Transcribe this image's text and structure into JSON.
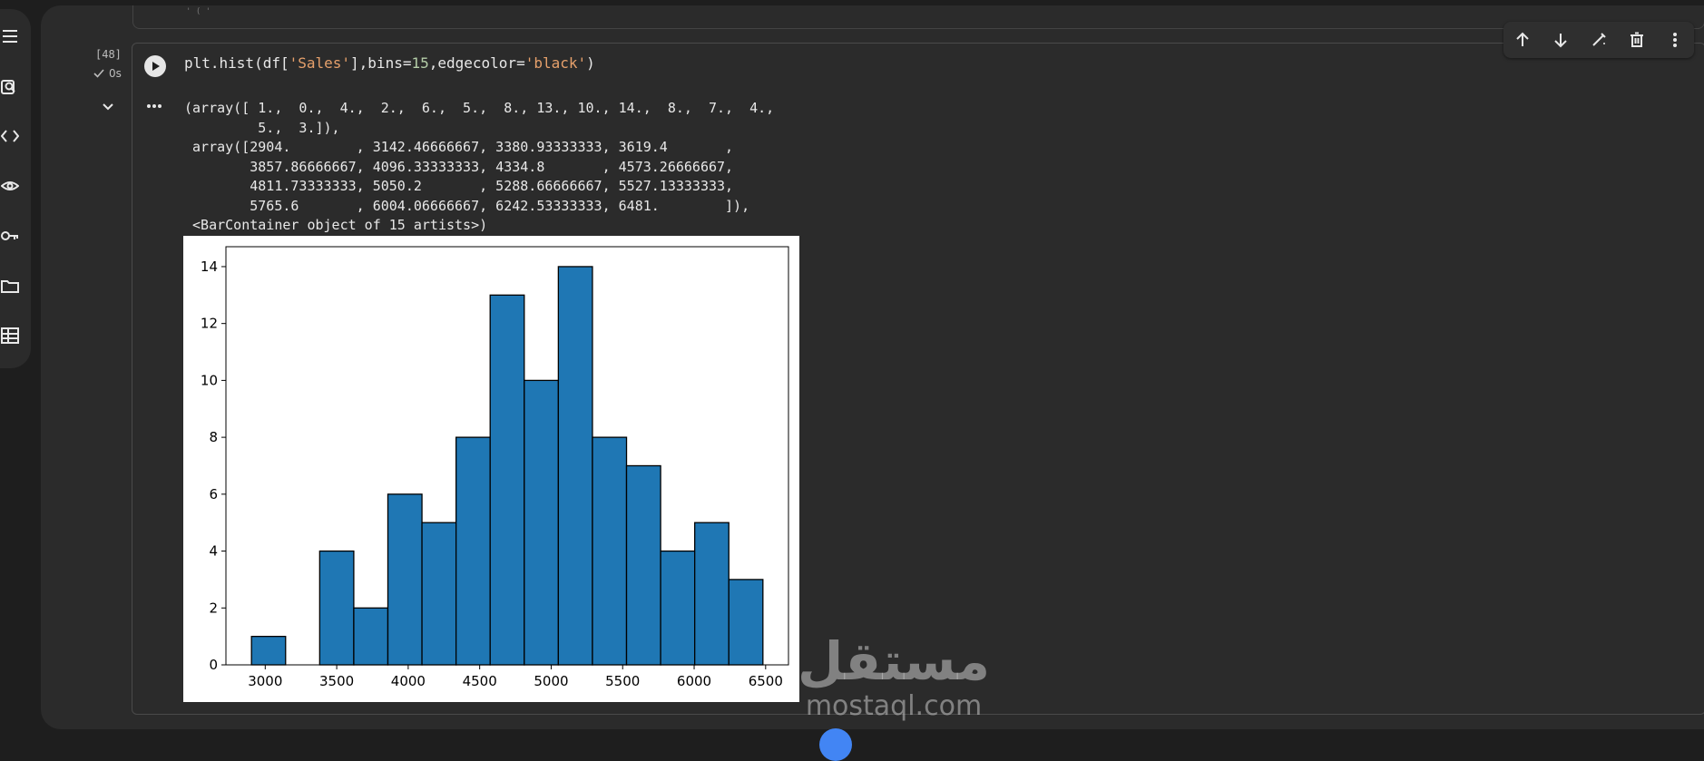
{
  "prev_cell": {
    "text": "' (             '"
  },
  "cell": {
    "execution_count": "[48]",
    "exec_time": "0s",
    "code": {
      "p1": "plt.hist(df[",
      "s1": "'Sales'",
      "p2": "],bins=",
      "n1": "15",
      "p3": ",edgecolor=",
      "s2": "'black'",
      "p4": ")"
    },
    "output_text": "(array([ 1.,  0.,  4.,  2.,  6.,  5.,  8., 13., 10., 14.,  8.,  7.,  4.,\n         5.,  3.]),\n array([2904.        , 3142.46666667, 3380.93333333, 3619.4       ,\n        3857.86666667, 4096.33333333, 4334.8       , 4573.26666667,\n        4811.73333333, 5050.2       , 5288.66666667, 5527.13333333,\n        5765.6       , 6004.06666667, 6242.53333333, 6481.        ]),\n <BarContainer object of 15 artists>)"
  },
  "toolbar": {
    "icons": [
      "arrow-up-icon",
      "arrow-down-icon",
      "edit-icon",
      "trash-icon",
      "more-vert-icon"
    ]
  },
  "left_rail": {
    "icons": [
      "menu-icon",
      "search-icon",
      "code-icon",
      "variables-icon",
      "key-icon",
      "folder-icon",
      "table-icon"
    ]
  },
  "watermark": {
    "arabic": "مستقل",
    "latin": "mostaql.com"
  },
  "colors": {
    "bar_fill": "#1f77b4",
    "bar_edge": "#000000",
    "accent": "#4285f4"
  },
  "chart_data": {
    "type": "bar",
    "bin_edges": [
      2904,
      3142.46666667,
      3380.93333333,
      3619.4,
      3857.86666667,
      4096.33333333,
      4334.8,
      4573.26666667,
      4811.73333333,
      5050.2,
      5288.66666667,
      5527.13333333,
      5765.6,
      6004.06666667,
      6242.53333333,
      6481
    ],
    "values": [
      1,
      0,
      4,
      2,
      6,
      5,
      8,
      13,
      10,
      14,
      8,
      7,
      4,
      5,
      3
    ],
    "xlim": [
      2725.15,
      6659.85
    ],
    "ylim": [
      0,
      14.7
    ],
    "xticks": [
      3000,
      3500,
      4000,
      4500,
      5000,
      5500,
      6000,
      6500
    ],
    "yticks": [
      0,
      2,
      4,
      6,
      8,
      10,
      12,
      14
    ],
    "grid": false,
    "title": "",
    "xlabel": "",
    "ylabel": ""
  }
}
